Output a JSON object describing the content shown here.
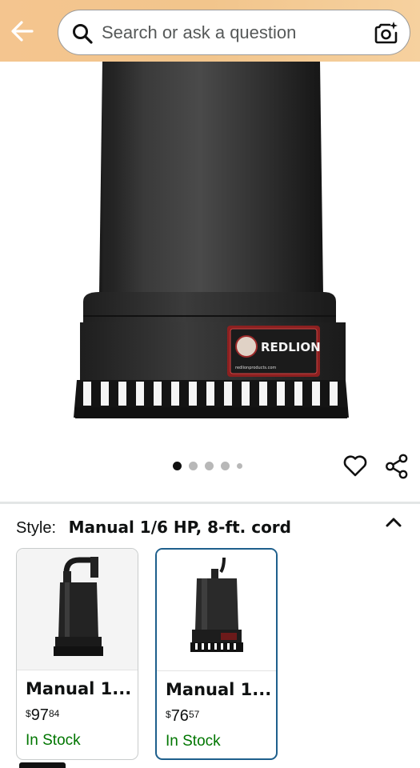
{
  "header": {
    "search_placeholder": "Search or ask a question",
    "back_icon": "back-arrow-icon",
    "camera_icon": "camera-sparkle-icon",
    "gradient_color": "#f4c58f"
  },
  "product_image": {
    "brand_label": "REDLION",
    "brand_sub": "redlionproducts.com"
  },
  "carousel": {
    "total_dots": 5,
    "active_index": 0
  },
  "actions": {
    "wishlist_icon": "heart-icon",
    "share_icon": "share-icon"
  },
  "style_selector": {
    "label": "Style:",
    "value": "Manual 1/6 HP, 8-ft. cord",
    "collapse_icon": "chevron-up-icon"
  },
  "variations": [
    {
      "title": "Manual 1...",
      "price_currency": "$",
      "price_whole": "97",
      "price_fraction": "84",
      "stock": "In Stock",
      "selected": false
    },
    {
      "title": "Manual 1...",
      "price_currency": "$",
      "price_whole": "76",
      "price_fraction": "57",
      "stock": "In Stock",
      "selected": true
    }
  ],
  "colors": {
    "in_stock": "#007600",
    "selected_border": "#1e5f8c",
    "text": "#0f1111"
  }
}
